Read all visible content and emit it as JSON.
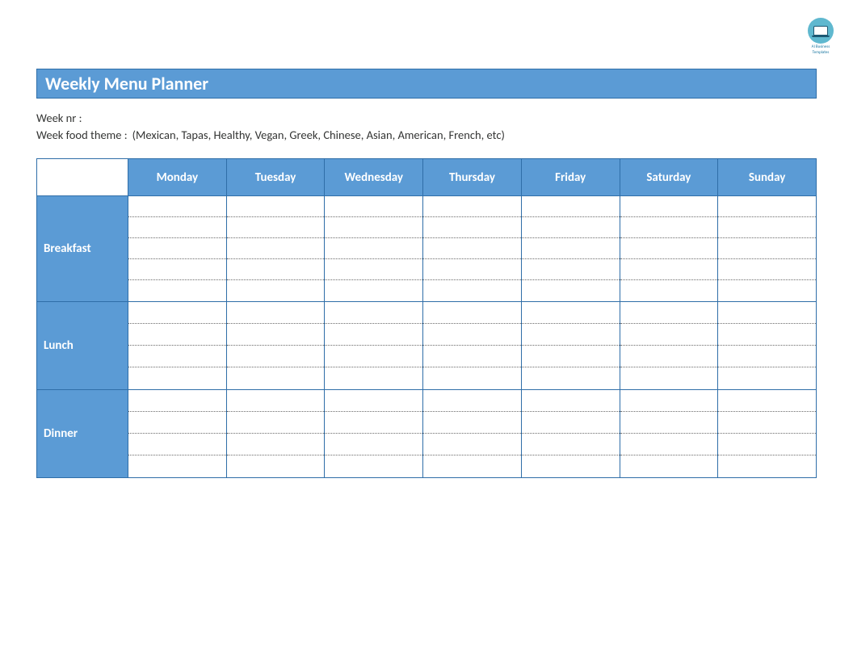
{
  "logo": {
    "line1": "Al Business",
    "line2": "Templates"
  },
  "header": {
    "title": "Weekly Menu Planner"
  },
  "meta": {
    "week_nr_label": "Week nr :",
    "week_nr_value": "",
    "theme_label": "Week food theme :",
    "theme_value": "(Mexican, Tapas, Healthy, Vegan, Greek, Chinese, Asian, American, French, etc)"
  },
  "table": {
    "days": [
      "Monday",
      "Tuesday",
      "Wednesday",
      "Thursday",
      "Friday",
      "Saturday",
      "Sunday"
    ],
    "meals": [
      {
        "name": "Breakfast",
        "lines": 5
      },
      {
        "name": "Lunch",
        "lines": 4
      },
      {
        "name": "Dinner",
        "lines": 4
      }
    ]
  }
}
